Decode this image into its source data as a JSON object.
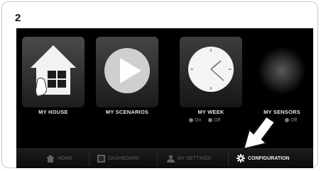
{
  "step_number": "2",
  "tiles": [
    {
      "label": "MY HOUSE",
      "icon": "house-with-hand-icon"
    },
    {
      "label": "MY SCENARIOS",
      "icon": "play-icon"
    },
    {
      "label": "MY WEEK",
      "icon": "clock-icon"
    },
    {
      "label": "MY SENSORS",
      "icon": "sensor-glow-icon"
    }
  ],
  "week_toggle": {
    "on": "On",
    "off": "Off"
  },
  "sensors_toggle": {
    "off": "Off"
  },
  "nav": {
    "home": "HOME",
    "dashboard": "DASHBOARD",
    "settings": "MY SETTINGS",
    "configuration": "CONFIGURATION"
  },
  "colors": {
    "screen_bg": "#000000",
    "active_nav_text": "#f0f0f0",
    "inactive_nav_text": "#5f5f5f"
  }
}
